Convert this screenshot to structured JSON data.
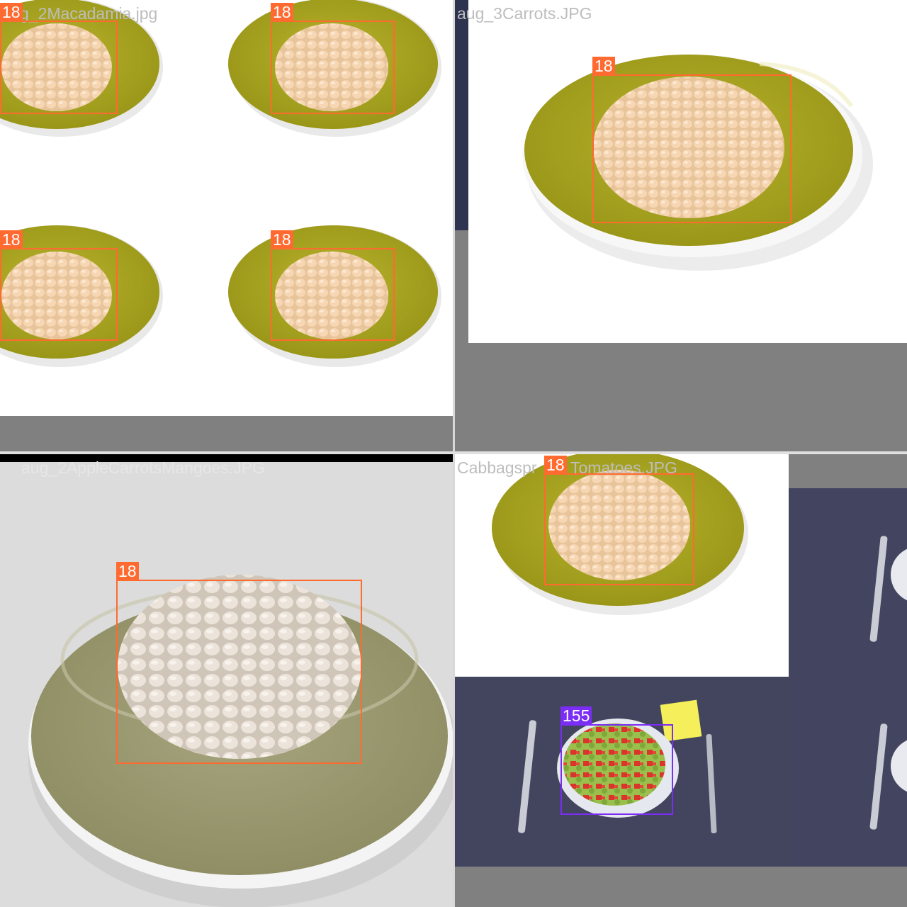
{
  "mosaic": {
    "tiles": [
      {
        "filename": "aug_2Macadamia.jpg",
        "filename_visible": "g_2Macadamia.jpg"
      },
      {
        "filename": "aug_3Carrots.JPG"
      },
      {
        "filename": "aug_2AppleCarrotsMangoes.JPG"
      },
      {
        "filename": "CabbagsproutTomatoes.JPG",
        "filename_visible": "Cabbagspr"
      },
      {
        "filename_suffix": "Tomatoes.JPG"
      }
    ],
    "boxes": [
      {
        "label": "18",
        "color": "#ff6a30"
      },
      {
        "label": "18",
        "color": "#ff6a30"
      },
      {
        "label": "18",
        "color": "#ff6a30"
      },
      {
        "label": "18",
        "color": "#ff6a30"
      },
      {
        "label": "18",
        "color": "#ff6a30"
      },
      {
        "label": "18",
        "color": "#ff6a30"
      },
      {
        "label": "18",
        "color": "#ff6a30"
      },
      {
        "label": "155",
        "color": "#7b2cf5"
      }
    ]
  },
  "colors": {
    "plate_olive": "#a7a424",
    "plate_sage": "#9c9a72",
    "nut": "#f2cfa7",
    "nut_pale": "#e8ddd0",
    "pad_gray": "#808080",
    "table_navy": "#43455f",
    "box_orange": "#ff6a30",
    "box_purple": "#7b2cf5"
  }
}
